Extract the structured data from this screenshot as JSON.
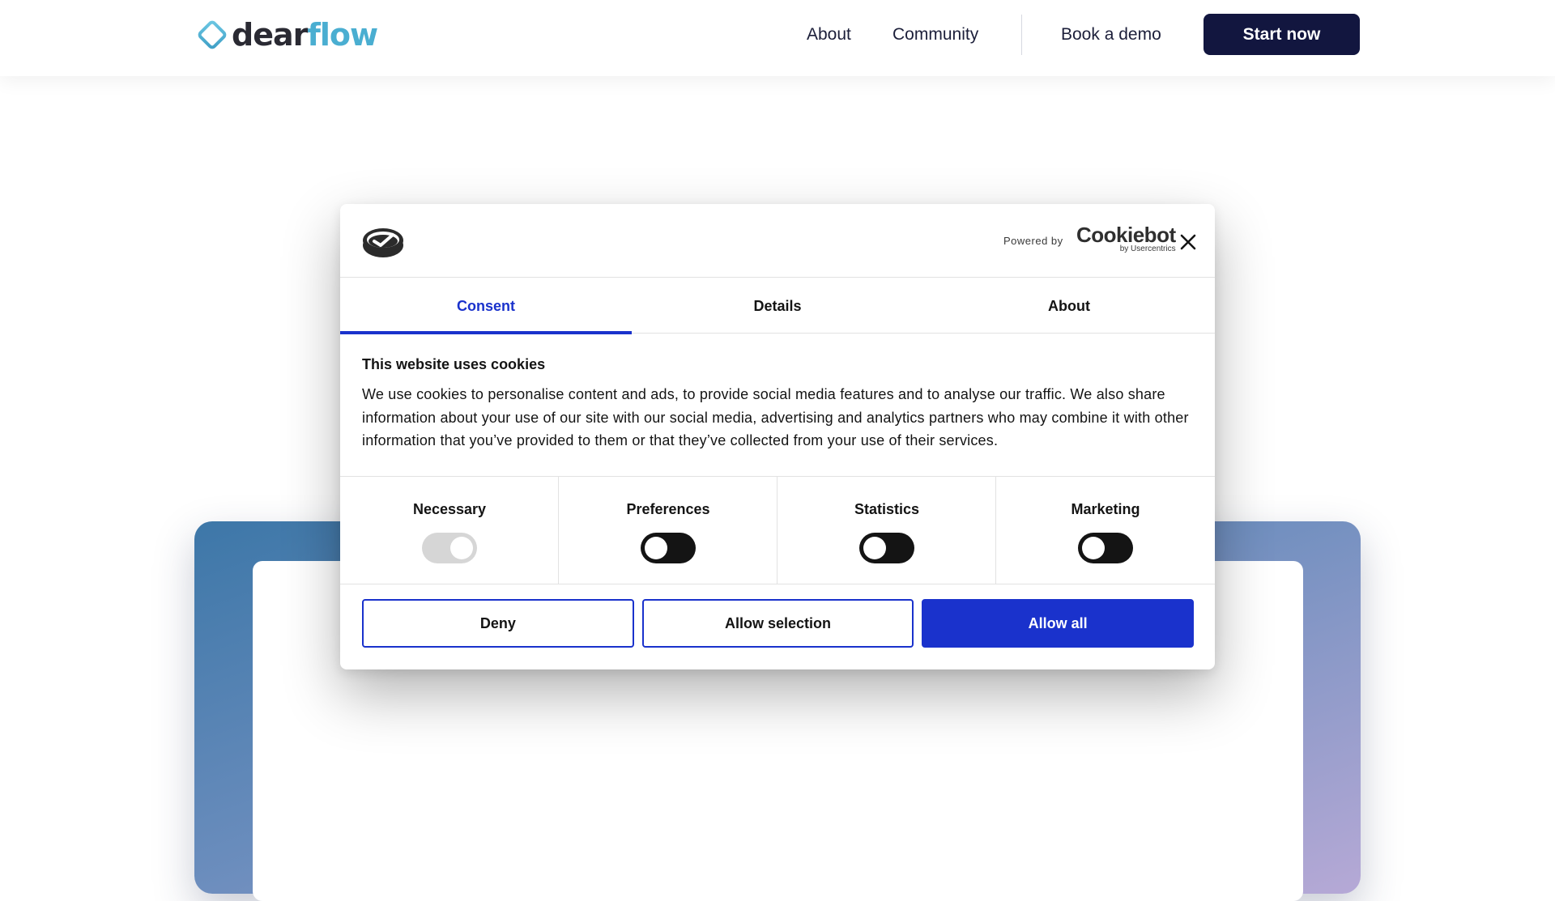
{
  "header": {
    "logo": {
      "dear": "dear",
      "flow": "flow"
    },
    "nav": {
      "about": "About",
      "community": "Community",
      "book_demo": "Book a demo"
    },
    "start_now": "Start now"
  },
  "cookie_dialog": {
    "powered_by": "Powered by",
    "brand": "Cookiebot",
    "brand_sub": "by Usercentrics",
    "tabs": [
      {
        "label": "Consent",
        "active": true
      },
      {
        "label": "Details",
        "active": false
      },
      {
        "label": "About",
        "active": false
      }
    ],
    "title": "This website uses cookies",
    "text": "We use cookies to personalise content and ads, to provide social media features and to analyse our traffic. We also share information about your use of our site with our social media, advertising and analytics partners who may combine it with other information that you’ve provided to them or that they’ve collected from your use of their services.",
    "categories": [
      {
        "label": "Necessary",
        "enabled": true,
        "disabled": true
      },
      {
        "label": "Preferences",
        "enabled": false,
        "disabled": false
      },
      {
        "label": "Statistics",
        "enabled": false,
        "disabled": false
      },
      {
        "label": "Marketing",
        "enabled": false,
        "disabled": false
      }
    ],
    "buttons": {
      "deny": "Deny",
      "allow_selection": "Allow selection",
      "allow_all": "Allow all"
    }
  },
  "colors": {
    "brand_navy": "#12163f",
    "logo_teal": "#4aaed1",
    "cookiebot_blue": "#1a32cc"
  }
}
